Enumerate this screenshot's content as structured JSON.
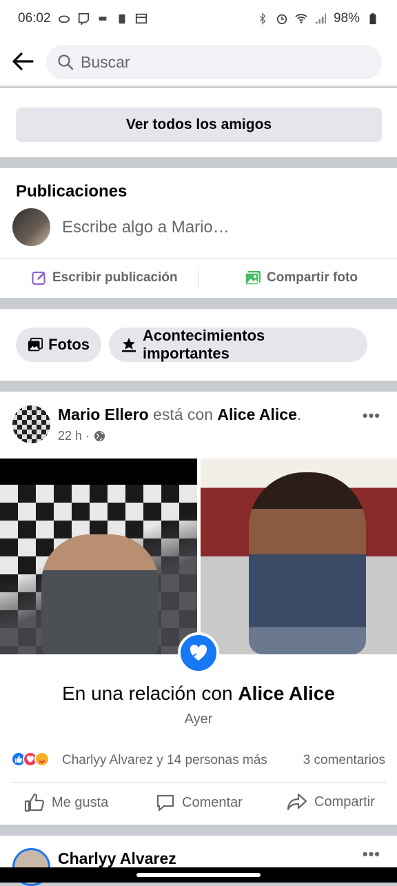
{
  "status_bar": {
    "time": "06:02",
    "battery": "98%"
  },
  "search": {
    "placeholder": "Buscar"
  },
  "friends": {
    "button_label": "Ver todos los amigos"
  },
  "publications": {
    "title": "Publicaciones",
    "composer_placeholder": "Escribe algo a Mario…",
    "write_post_label": "Escribir publicación",
    "share_photo_label": "Compartir foto"
  },
  "filters": {
    "photos_label": "Fotos",
    "life_events_label": "Acontecimientos importantes"
  },
  "post": {
    "author": "Mario Ellero",
    "connector": " está con ",
    "tagged": "Alice Alice",
    "period": ".",
    "time": "22 h ·",
    "relationship_prefix": "En una relación con ",
    "relationship_name": "Alice Alice",
    "relationship_date": "Ayer",
    "reactions_text": "Charlyy Alvarez y 14 personas más",
    "comments_count": "3 comentarios",
    "like_label": "Me gusta",
    "comment_label": "Comentar",
    "share_label": "Compartir"
  },
  "next_post": {
    "author": "Charlyy Alvarez"
  },
  "colors": {
    "accent": "#1877f2",
    "background": "#c9ccd1",
    "button_gray": "#e4e6eb",
    "text_secondary": "#65676b"
  }
}
